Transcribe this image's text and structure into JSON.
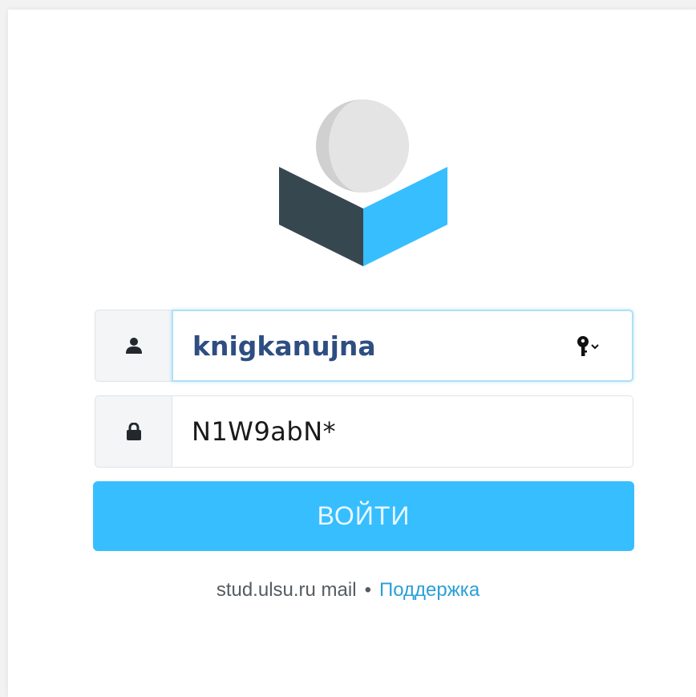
{
  "login_form": {
    "username": {
      "icon": "user-icon",
      "value": "knigkanujna",
      "password_manager_icon": "key-icon"
    },
    "password": {
      "icon": "lock-icon",
      "value": "N1W9abN*"
    },
    "submit_label": "ВОЙТИ"
  },
  "footer": {
    "product_name": "stud.ulsu.ru mail",
    "separator": "•",
    "support_link": "Поддержка"
  },
  "colors": {
    "accent": "#37beff",
    "logo_dark": "#37474f",
    "logo_ball": "#d9d9d9",
    "link": "#2a9fd6",
    "username_text": "#2e4e82"
  }
}
